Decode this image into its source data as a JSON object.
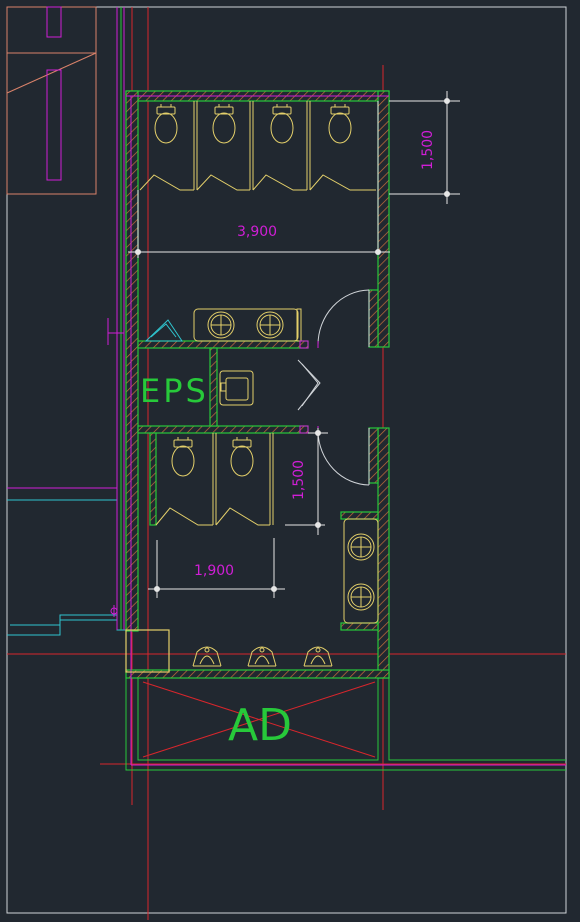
{
  "colors": {
    "background": "#212830",
    "frame": "#d0d4d8",
    "wall": "#27c93a",
    "fixture": "#e3cf6a",
    "dimension": "#d01ed6",
    "axis": "#d8262c",
    "dimline": "#e6e6e6",
    "cyan": "#2fc5cf",
    "salmon": "#d9826a"
  },
  "dimensions": {
    "top_width": "3,900",
    "top_depth": "1,500",
    "bottom_depth": "1,500",
    "bottom_width": "1,900"
  },
  "rooms": {
    "eps": "EPS",
    "ad": "AD"
  },
  "fixtures": {
    "top_toilets": 4,
    "bottom_toilets": 2,
    "urinals": 3,
    "top_sinks": 2,
    "side_sinks": 2
  }
}
